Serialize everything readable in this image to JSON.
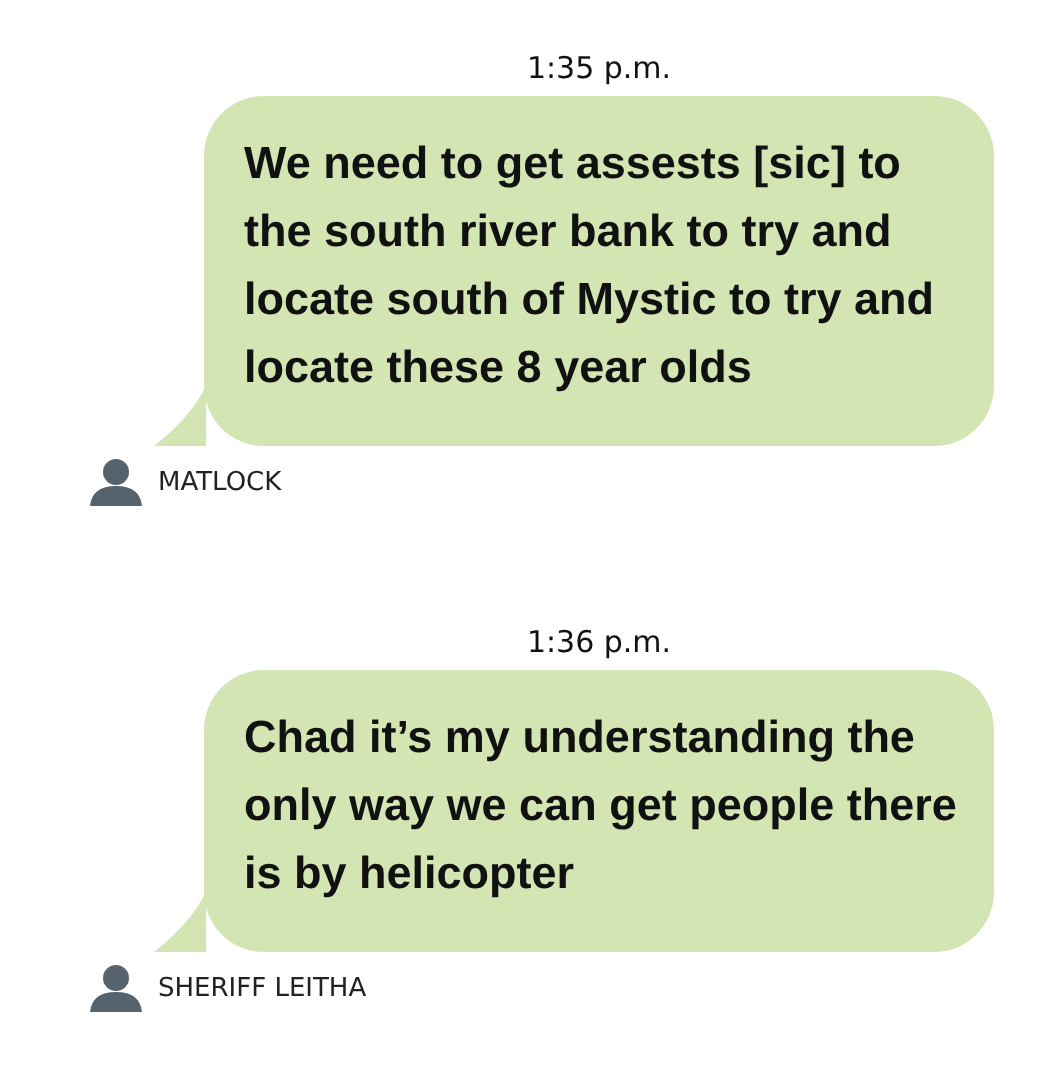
{
  "messages": [
    {
      "time": "1:35 p.m.",
      "text": "We need to get assests [sic] to the south river bank to try and locate south of Mystic to try and locate these 8 year olds",
      "sender": "MATLOCK"
    },
    {
      "time": "1:36 p.m.",
      "text": "Chad it’s my understanding the only way we can get people there is by helicopter",
      "sender": "SHERIFF LEITHA"
    }
  ]
}
